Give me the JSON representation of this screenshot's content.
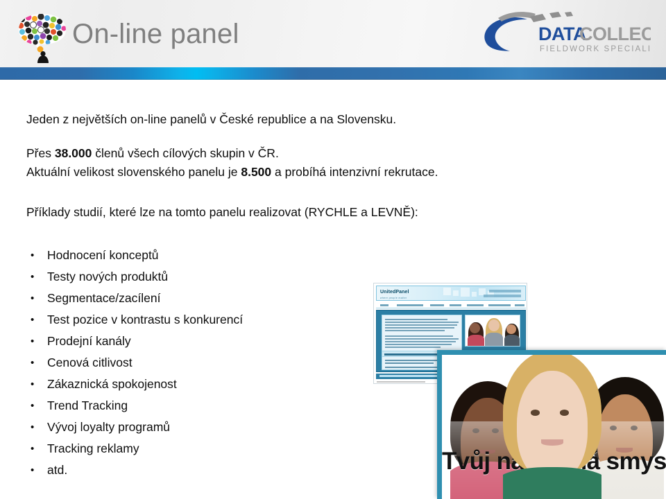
{
  "header": {
    "title": "On-line panel",
    "bubble_icon": "speech-bubble-mosaic-icon",
    "logo": {
      "word_one": "DATA",
      "word_two": "COLLECT",
      "tagline": "FIELDWORK SPECIALIST",
      "color_blue": "#1f4e9c",
      "color_gray": "#9b9b9b"
    },
    "band_accent_color": "#00bdf2",
    "title_color": "#7f7f7f"
  },
  "content": {
    "intro": "Jeden z největších on-line panelů v České republice a na Slovensku.",
    "members_prefix": "Přes ",
    "members_count": "38.000",
    "members_suffix": " členů všech cílových skupin v ČR.",
    "size_prefix": "Aktuální velikost slovenského panelu je ",
    "size_count": "8.500",
    "size_suffix": "  a probíhá intenzivní rekrutace.",
    "studies_heading": "Příklady studií, které lze na tomto panelu realizovat (RYCHLE a LEVNĚ):",
    "bullets": [
      "Hodnocení konceptů",
      "Testy nových produktů",
      "Segmentace/zacílení",
      "Test pozice v kontrastu s konkurencí",
      "Prodejní kanály",
      "Cenová citlivost",
      "Zákaznická spokojenost",
      "Trend Tracking",
      "Vývoj loyalty programů",
      "Tracking reklamy",
      "atd."
    ]
  },
  "panel_shot": {
    "site": {
      "logo": "UnitedPanel",
      "logo_sub": "where people matter"
    },
    "banner": {
      "slogan": "Tvůj názor má smysl!",
      "border_color": "#2f8fb0"
    }
  }
}
